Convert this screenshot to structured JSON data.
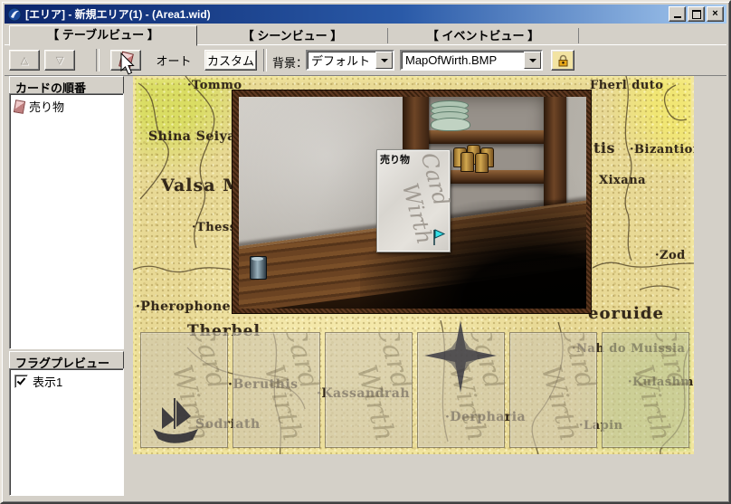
{
  "window": {
    "title": "[エリア] - 新規エリア(1) - (Area1.wid)"
  },
  "tabs": [
    {
      "label": "【 テーブルビュー 】",
      "selected": true
    },
    {
      "label": "【 シーンビュー 】",
      "selected": false
    },
    {
      "label": "【 イベントビュー 】",
      "selected": false
    }
  ],
  "toolbar": {
    "move_up": "△",
    "move_down": "▽",
    "auto": "オート",
    "custom": "カスタム",
    "background_label": "背景：",
    "background_value": "デフォルト",
    "file_value": "MapOfWirth.BMP"
  },
  "sidebar": {
    "card_order_header": "カードの順番",
    "card_items": [
      {
        "label": "売り物"
      }
    ],
    "flag_header": "フラグプレビュー",
    "flag_items": [
      {
        "label": "表示1",
        "checked": true
      }
    ]
  },
  "scene": {
    "card_label": "売り物",
    "watermark_line1": "Card",
    "watermark_line2": "Wirth"
  },
  "bottom_cards": {
    "watermark_line1": "Card",
    "watermark_line2": "Wirth"
  },
  "map_labels": [
    "·Tommo",
    "Fherl duto",
    "Shina Seiya",
    "tis",
    "·Bizantion",
    "Xixana",
    "Valsa Mut",
    "·Thessia",
    "·Zod",
    "·Pherophone",
    "eoruide",
    "Therbel",
    "·Beruthis",
    "·Kassandrah",
    "Sodriath",
    "·Derpharia",
    "·Nah do Muissia",
    "·Kulashmorle",
    "·Lapin"
  ],
  "colors": {
    "titlebar_left": "#0a246a",
    "titlebar_right": "#a6caf0",
    "chrome": "#d4d0c8",
    "parchment": "#e8d995",
    "flag": "#35e0e8",
    "lock_gold": "#e8a818"
  }
}
